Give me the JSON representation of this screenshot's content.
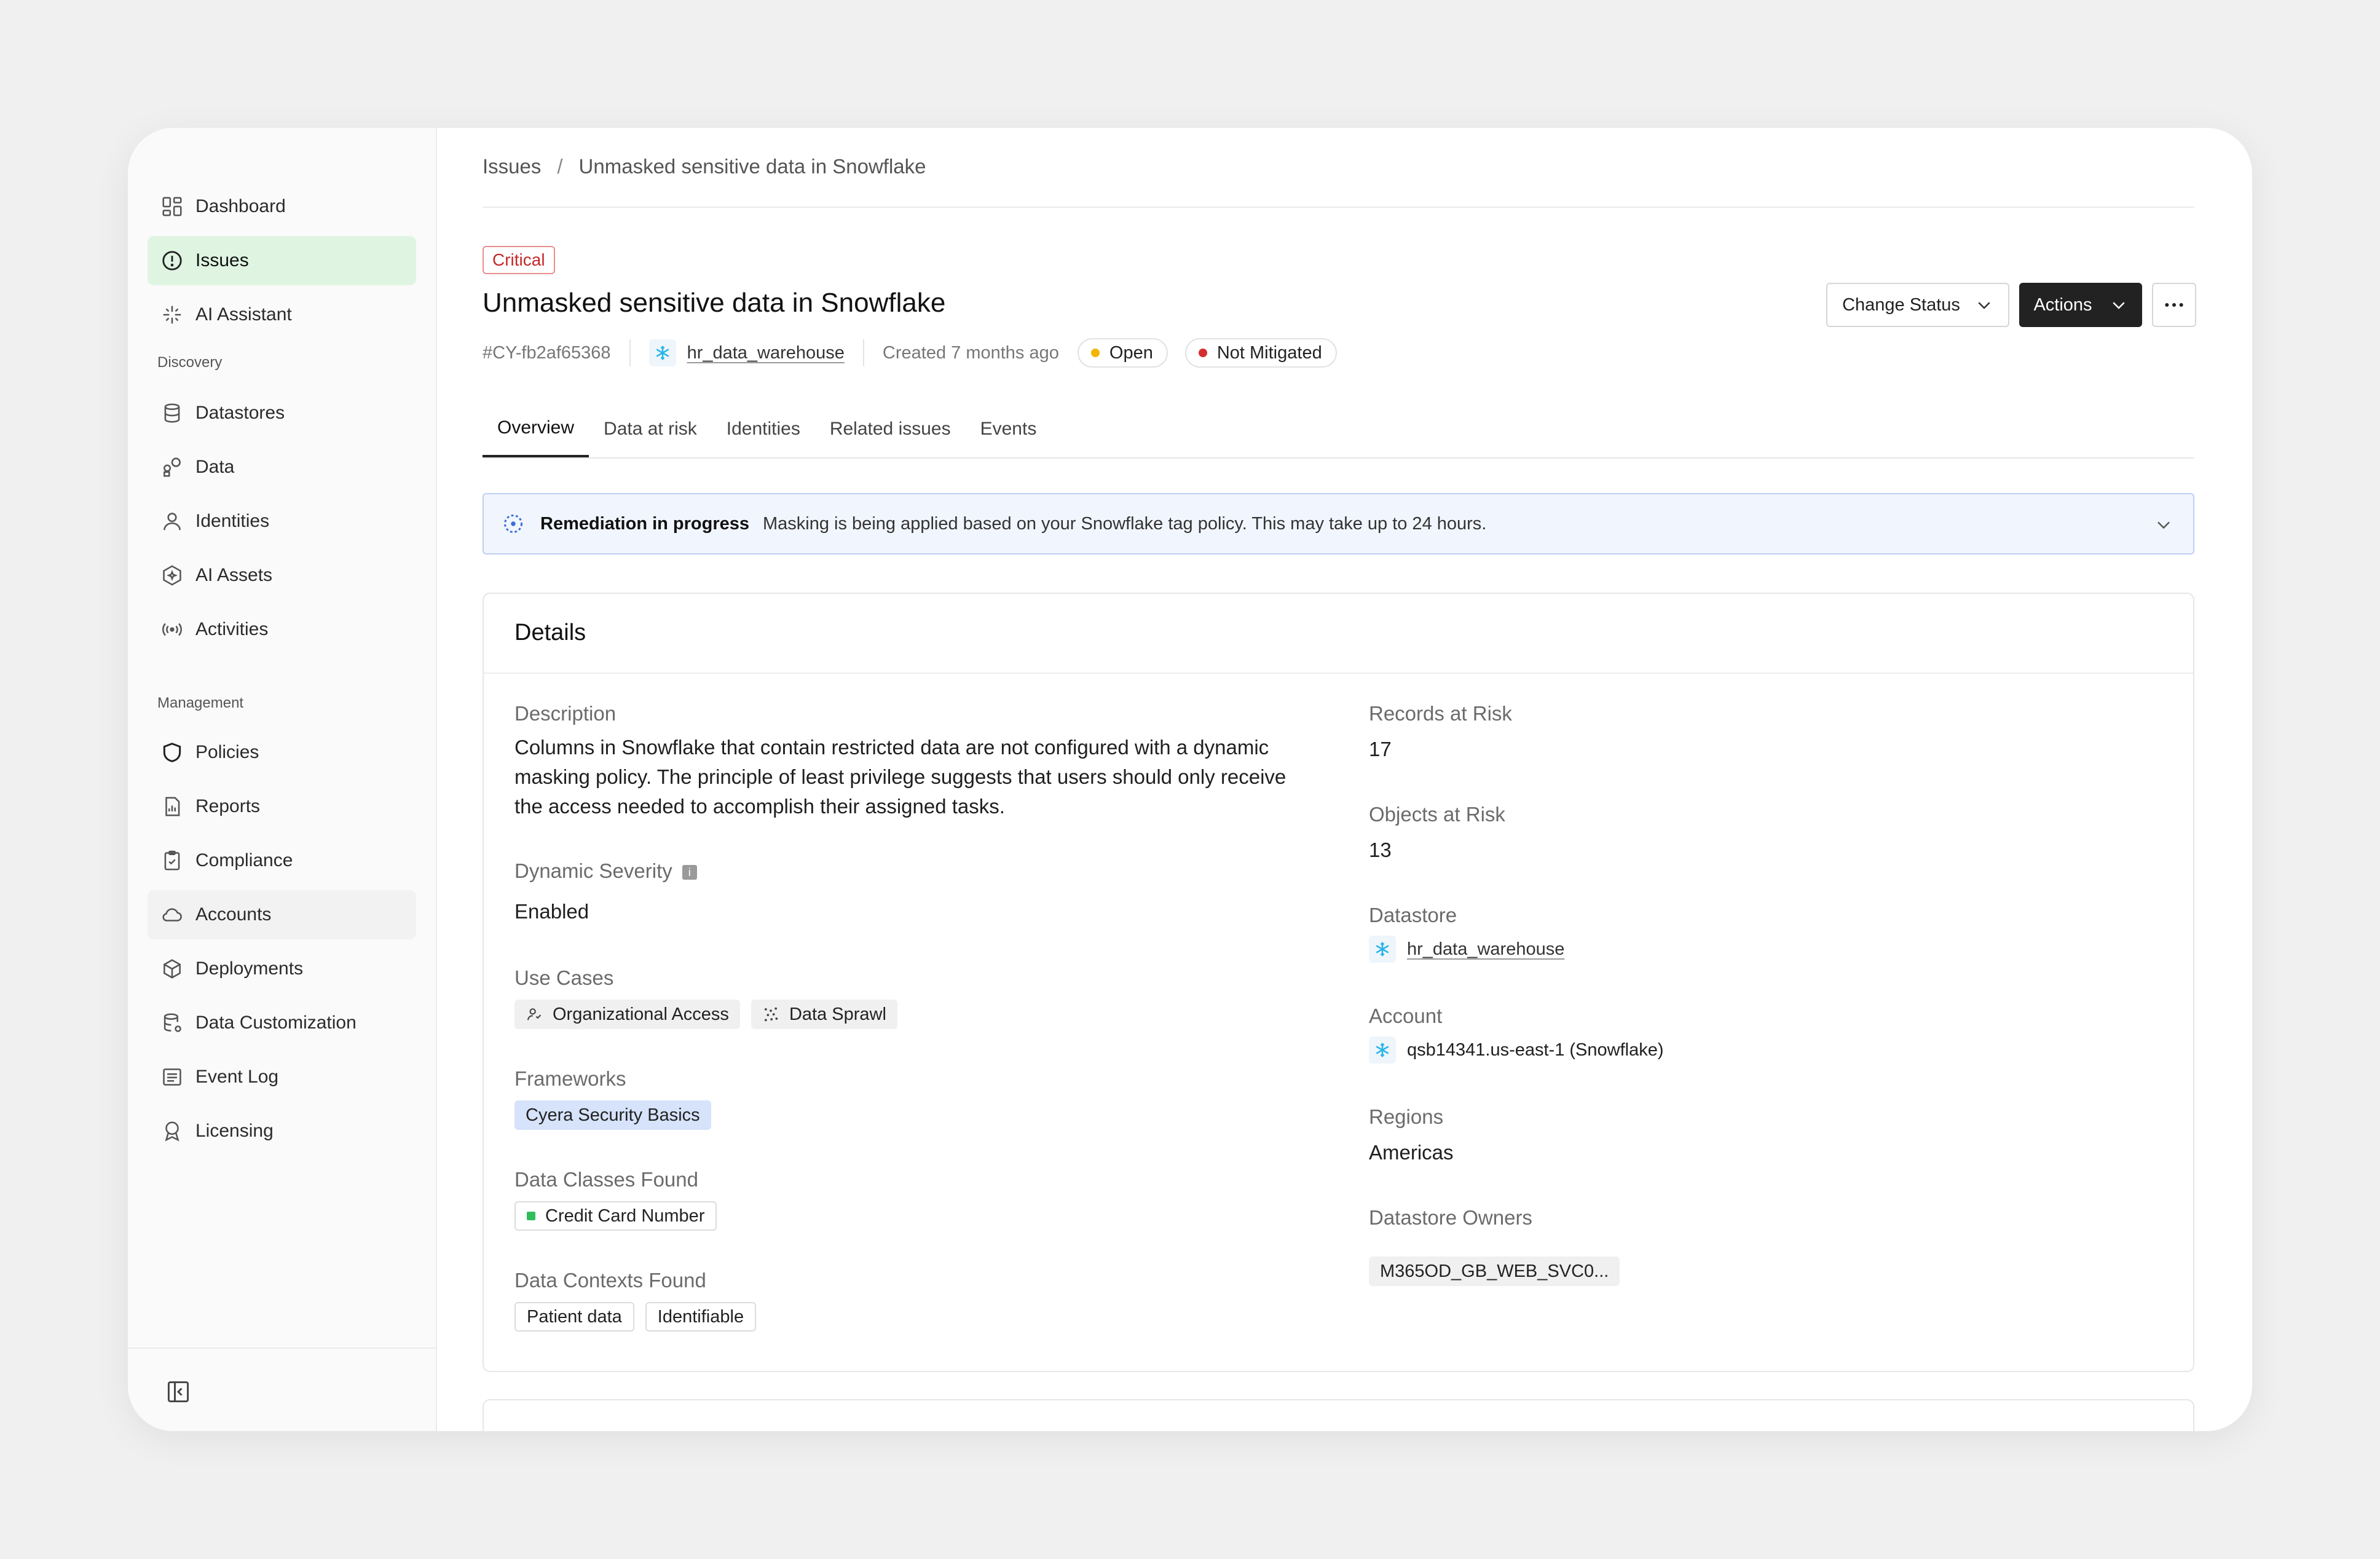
{
  "sidebar": {
    "items": [
      {
        "label": "Dashboard",
        "icon": "dashboard-icon"
      },
      {
        "label": "Issues",
        "icon": "alert-circle-icon",
        "active": true
      },
      {
        "label": "AI Assistant",
        "icon": "sparkle-icon"
      }
    ],
    "discovery_label": "Discovery",
    "discovery": [
      {
        "label": "Datastores",
        "icon": "database-icon"
      },
      {
        "label": "Data",
        "icon": "shapes-icon"
      },
      {
        "label": "Identities",
        "icon": "user-icon"
      },
      {
        "label": "AI Assets",
        "icon": "hexagon-icon"
      },
      {
        "label": "Activities",
        "icon": "broadcast-icon"
      }
    ],
    "management_label": "Management",
    "management": [
      {
        "label": "Policies",
        "icon": "shield-icon"
      },
      {
        "label": "Reports",
        "icon": "report-icon"
      },
      {
        "label": "Compliance",
        "icon": "clipboard-check-icon"
      },
      {
        "label": "Accounts",
        "icon": "cloud-icon"
      },
      {
        "label": "Deployments",
        "icon": "cube-icon"
      },
      {
        "label": "Data Customization",
        "icon": "database-gear-icon"
      },
      {
        "label": "Event Log",
        "icon": "list-icon"
      },
      {
        "label": "Licensing",
        "icon": "award-icon"
      }
    ]
  },
  "breadcrumb": {
    "root": "Issues",
    "separator": "/",
    "current": "Unmasked sensitive data in Snowflake"
  },
  "issue": {
    "severity": "Critical",
    "title": "Unmasked sensitive data in Snowflake",
    "id": "#CY-fb2af65368",
    "datastore": "hr_data_warehouse",
    "created": "Created 7 months ago",
    "status": "Open",
    "mitigation": "Not Mitigated"
  },
  "colors": {
    "status_open": "#f4b400",
    "not_mitigated": "#d32f2f",
    "accent_green": "#dff5e2",
    "critical": "#c62828"
  },
  "buttons": {
    "change_status": "Change Status",
    "actions": "Actions"
  },
  "tabs": [
    "Overview",
    "Data at risk",
    "Identities",
    "Related issues",
    "Events"
  ],
  "banner": {
    "title": "Remediation in progress",
    "text": "Masking is being applied based on your Snowflake tag policy. This may take up to 24 hours."
  },
  "details": {
    "title": "Details",
    "description_label": "Description",
    "description": "Columns in Snowflake that contain restricted data are not configured with a dynamic masking policy. The principle of least privilege suggests that users should only receive the access needed to accomplish their assigned tasks.",
    "dynamic_severity_label": "Dynamic Severity",
    "dynamic_severity": "Enabled",
    "use_cases_label": "Use Cases",
    "use_cases": [
      "Organizational Access",
      "Data Sprawl"
    ],
    "frameworks_label": "Frameworks",
    "frameworks": [
      "Cyera Security Basics"
    ],
    "data_classes_label": "Data Classes Found",
    "data_classes": [
      "Credit Card Number"
    ],
    "data_contexts_label": "Data Contexts Found",
    "data_contexts": [
      "Patient data",
      "Identifiable"
    ],
    "records_label": "Records at Risk",
    "records": "17",
    "objects_label": "Objects at Risk",
    "objects": "13",
    "datastore_label": "Datastore",
    "datastore": "hr_data_warehouse",
    "account_label": "Account",
    "account": "qsb14341.us-east-1 (Snowflake)",
    "regions_label": "Regions",
    "regions": "Americas",
    "owners_label": "Datastore Owners",
    "owners": [
      "M365OD_GB_WEB_SVC0..."
    ]
  }
}
